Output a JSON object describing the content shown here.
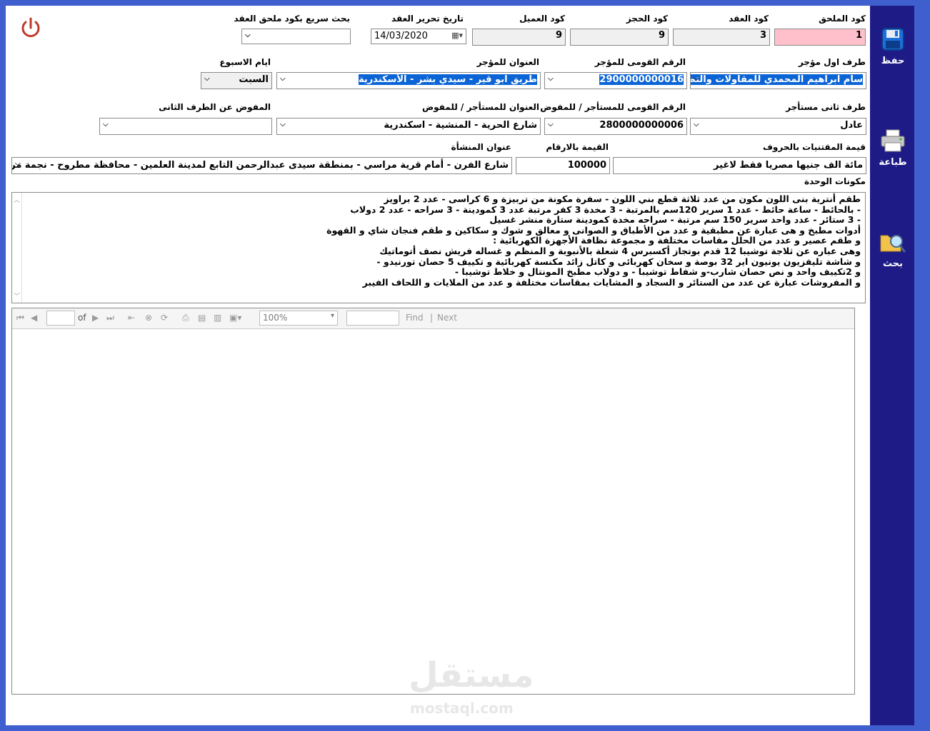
{
  "labels": {
    "addendum_code": "كود الملحق",
    "contract_code": "كود العقد",
    "booking_code": "كود الحجز",
    "client_code": "كود العميل",
    "contract_date": "تاريخ تحرير العقد",
    "quick_search": "بحث سريع بكود ملحق العقد",
    "first_party": "طرف اول مؤجر",
    "lessor_national_id": "الرقم القومى للمؤجر",
    "lessor_address": "العنوان للمؤجر",
    "weekdays": "ايام الاسبوع",
    "second_party": "طرف ثانى مستأجر",
    "tenant_national_id": "الرقم القومى للمستأجر / للمفوض",
    "tenant_address": "العنوان للمستأجر / للمفوض",
    "delegate_second": "المفوض عن الطرف الثانى",
    "value_words": "قيمة المقتنيات بالحروف",
    "value_numbers": "القيمة بالارقام",
    "facility_address": "عنوان المنشأة",
    "unit_components": "مكونات الوحدة"
  },
  "values": {
    "addendum_code": "1",
    "contract_code": "3",
    "booking_code": "9",
    "client_code": "9",
    "contract_date": "14/03/2020",
    "quick_search": "",
    "first_party": "سام ابراهيم المحمدي للمقاولات والتطوير العقاري",
    "lessor_national_id": "2900000000016",
    "lessor_address": "طريق ابو قير - سيدي بشر - الأسكندرية",
    "weekday": "السبت",
    "second_party": "عادل",
    "tenant_national_id": "2800000000006",
    "tenant_address": "شارع الحرية - المنشية - اسكندرية",
    "delegate_second": "",
    "value_words": "مائة الف جنيها مصريا فقط لاغير",
    "value_numbers": "100000",
    "facility_address": "شارع الفرن - أمام قرية مراسي - بمنطقة سيدى عبدالرحمن التابع لمدينة العلمين - محافظة مطروح - نجمة مراسى"
  },
  "components_lines": [
    "طقم أنترية بنى اللون مكون من عدد ثلاثة قطع بني اللون - سفرة مكونة من تربيزة و 6 كراسى - عدد 2 براويز",
    "- بالحائط - ساعة حائط - عدد 1 سرير 120سم بالمرتبة - 3 مخدة 3 كفر مرتبة عدد 3 كمودينة - 3 سراحه - عدد 2 دولاب",
    "- 3 ستائر - عدد واحد سرير 150 سم مرتبة - سراحه مخدة كمودينة ستارة منشر غسيل",
    "أدوات مطبخ و هى عبارة عن مطبقية و عدد من الأطباق و الصوانى و معالق و شوك و سكاكين و طقم فنجان شاي و القهوة",
    "و طقم عصير و عدد من الحلل مقاسات مختلفة و مجموعة نظافة الأجهزة الكهربائية :",
    "وهى عباره عن ثلاجة توشيبا 12 قدم بوتجاز أكسبرس 4 شعلة بالأنبوبة و المنظم و غساله فريش نصف أتوماتيك",
    "و شاشة تليفزيون يونيون اير 32 بوصة و سخان كهربائى و كاتل زائد مكنسة كهربائية و تكييف 5 حصان تورنيدو -",
    "و 2تكييف واحد و نص حصان شارب-و  شفاط توشيبا - و دولاب مطبخ المونتال و خلاط توشيبا -",
    "و المفروشات عبارة عن عدد من الستائر و السجاد و المشايات بمقاسات مختلفة و عدد من الملايات و اللحاف الفيبر"
  ],
  "viewer": {
    "page_input": "",
    "of_label": "of",
    "zoom": "100%",
    "find_input": "",
    "find_label": "Find",
    "next_label": "Next"
  },
  "sidebar": {
    "save": "حفظ",
    "print": "طباعة",
    "search": "بحث"
  },
  "watermark": {
    "arabic": "مستقل",
    "latin": "mostaql.com"
  },
  "icons": {
    "power": "power-icon",
    "save": "floppy-disk-icon",
    "print": "printer-icon",
    "search": "folder-search-icon",
    "dropdown": "chevron-down-icon",
    "calendar": "calendar-icon"
  },
  "colors": {
    "sidebar": "#1e1b86",
    "frame": "#3f5fcf",
    "pink_field": "#ffc0cb",
    "highlight": "#0a64d6",
    "power": "#c0392b"
  }
}
